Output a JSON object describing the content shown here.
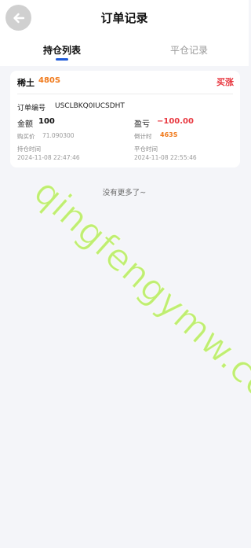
{
  "header": {
    "title": "订单记录"
  },
  "tabs": [
    {
      "label": "持仓列表",
      "active": true
    },
    {
      "label": "平仓记录",
      "active": false
    }
  ],
  "order": {
    "product": "稀土",
    "duration": "480S",
    "direction": "买涨",
    "order_no_label": "订单编号",
    "order_no": "USCLBKQ0IUCSDHT",
    "amount_label": "金额",
    "amount": "100",
    "pnl_label": "盈亏",
    "pnl": "−100.00",
    "buy_price_label": "购买价",
    "buy_price": "71.090300",
    "countdown_label": "倒计时",
    "countdown": "463S",
    "hold_time_label": "持仓时间",
    "hold_time": "2024-11-08 22:47:46",
    "close_time_label": "平仓时间",
    "close_time": "2024-11-08 22:55:46"
  },
  "list_end_text": "没有更多了~",
  "watermark": "qingfengymw.com",
  "colors": {
    "accent": "#1f5bd8",
    "up_red": "#e8373f",
    "duration_orange": "#f07a1c",
    "watermark_green": "#aaeb3c"
  }
}
